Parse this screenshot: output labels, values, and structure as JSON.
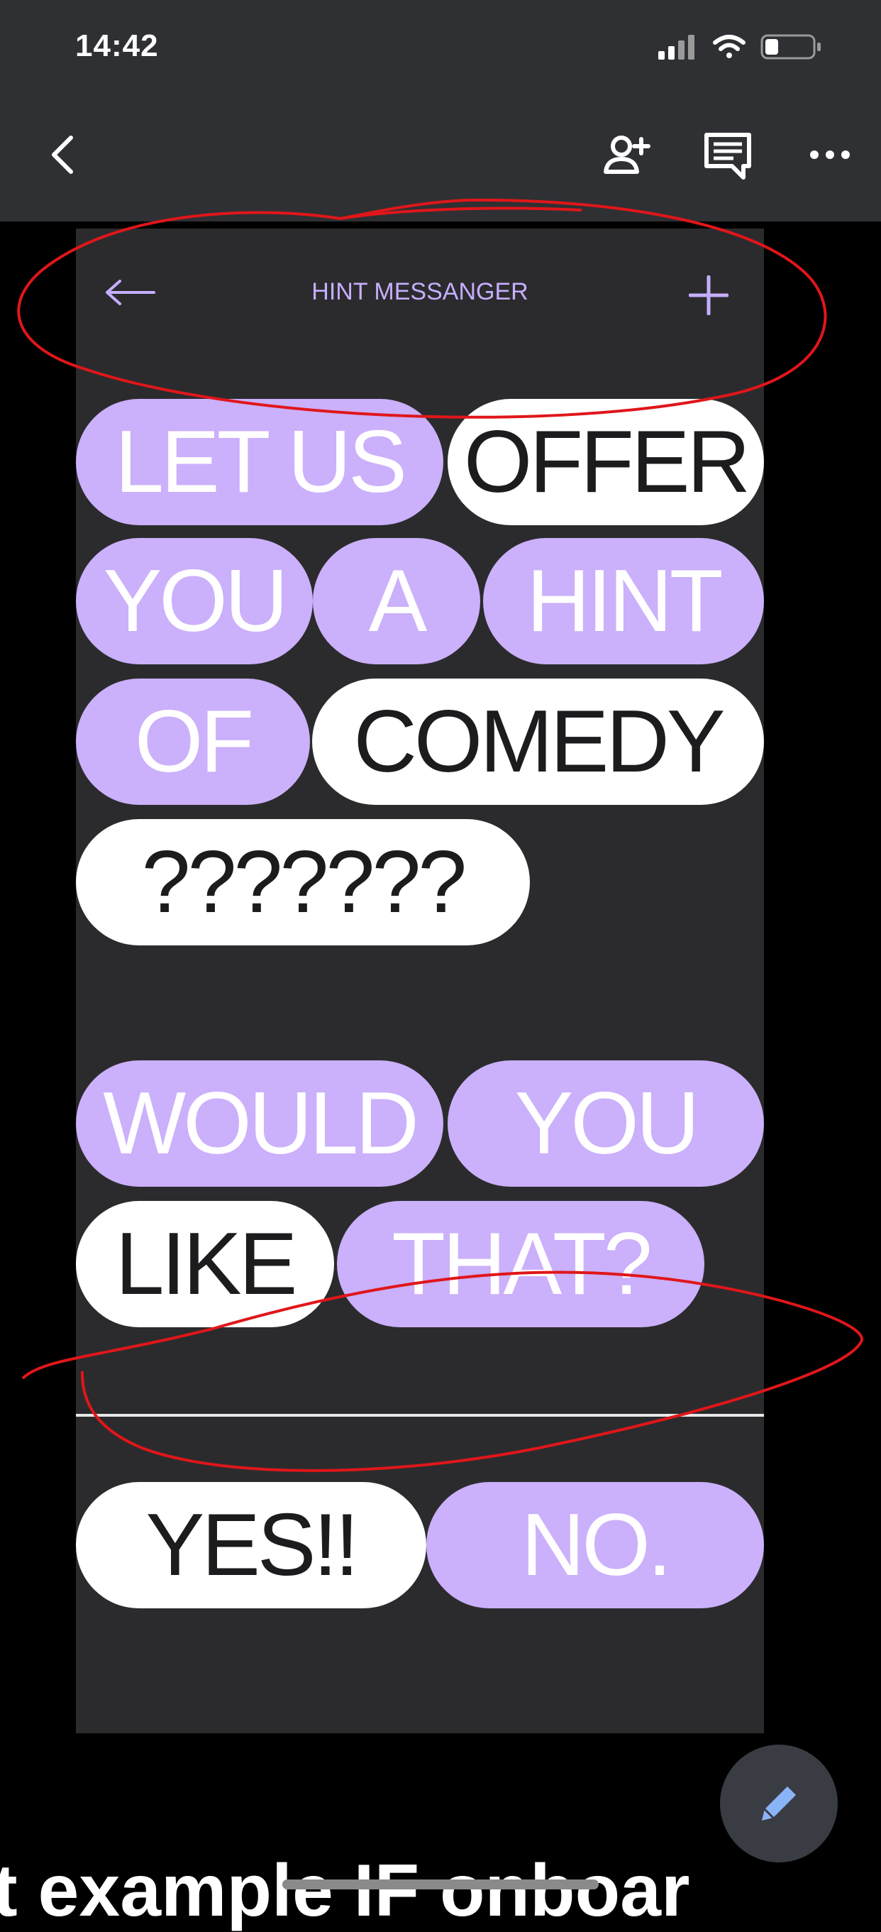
{
  "status_bar": {
    "time": "14:42"
  },
  "artboard": {
    "header_title": "HINT MESSANGER",
    "icons": {
      "back": "arrow-left-icon",
      "add": "plus-icon"
    },
    "message_words": [
      "LET US",
      "OFFER",
      "YOU",
      "A",
      "HINT",
      "OF",
      "COMEDY",
      "???????"
    ],
    "question_words": [
      "WOULD",
      "YOU",
      "LIKE",
      "THAT?"
    ],
    "answers": [
      "YES!!",
      "NO."
    ]
  },
  "bottom_text": "t example IF onboar",
  "colors": {
    "accent_purple": "#cbb0fb",
    "header_purple": "#c6aeff",
    "annotation_red": "#e0161a",
    "fab_pen_blue": "#8ab4f8"
  },
  "icons": {
    "nav_back": "chevron-left-icon",
    "nav_add_person": "add-person-icon",
    "nav_comment": "comment-icon",
    "nav_more": "more-horizontal-icon",
    "fab": "pencil-icon"
  }
}
